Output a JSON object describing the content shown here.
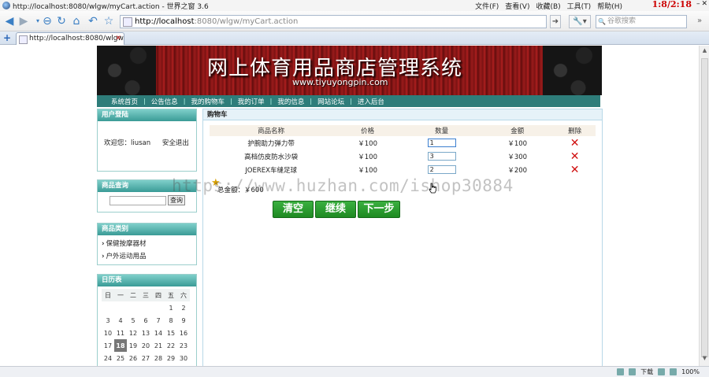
{
  "browser": {
    "window_title": "http://localhost:8080/wlgw/myCart.action - 世界之窗 3.6",
    "menus": [
      "文件(F)",
      "查看(V)",
      "收藏(B)",
      "工具(T)",
      "帮助(H)"
    ],
    "clock": "1:8/2:18",
    "url_host": "http://localhost",
    "url_rest": ":8080/wlgw/myCart.action",
    "search_placeholder": "谷歌搜索",
    "tab_title": "http://localhost:8080/wlgw...",
    "status_download": "下载",
    "status_zoom": "100%"
  },
  "site": {
    "name": "网上体育用品商店管理系统",
    "domain": "www.tiyuyongpin.com",
    "nav": [
      "系统首页",
      "公告信息",
      "我的购物车",
      "我的订单",
      "我的信息",
      "网站论坛",
      "进入后台"
    ]
  },
  "sidebar": {
    "login_title": "用户登陆",
    "welcome": "欢迎您：liusan",
    "logout": "安全退出",
    "search_title": "商品查询",
    "search_button": "查询",
    "category_title": "商品类别",
    "categories": [
      "保健按摩器材",
      "户外运动用品"
    ],
    "calendar_title": "日历表",
    "calendar": {
      "weekdays": [
        "日",
        "一",
        "二",
        "三",
        "四",
        "五",
        "六"
      ],
      "weeks": [
        [
          "",
          "",
          "",
          "",
          "",
          "1",
          "2"
        ],
        [
          "3",
          "4",
          "5",
          "6",
          "7",
          "8",
          "9"
        ],
        [
          "10",
          "11",
          "12",
          "13",
          "14",
          "15",
          "16"
        ],
        [
          "17",
          "18",
          "19",
          "20",
          "21",
          "22",
          "23"
        ],
        [
          "24",
          "25",
          "26",
          "27",
          "28",
          "29",
          "30"
        ]
      ],
      "today": "18"
    }
  },
  "cart": {
    "title": "购物车",
    "columns": [
      "商品名称",
      "价格",
      "数量",
      "金额",
      "删除"
    ],
    "rows": [
      {
        "name": "护腕助力弹力带",
        "price": "￥100",
        "qty": "1",
        "amount": "￥100"
      },
      {
        "name": "高档仿皮防水沙袋",
        "price": "￥100",
        "qty": "3",
        "amount": "￥300"
      },
      {
        "name": "JOEREX车缝足球",
        "price": "￥100",
        "qty": "2",
        "amount": "￥200"
      }
    ],
    "total_label": "总金额：￥600",
    "buttons": {
      "clear": "清空",
      "continue": "继续",
      "next": "下一步"
    }
  },
  "watermark": "https://www.huzhan.com/ishop30884"
}
